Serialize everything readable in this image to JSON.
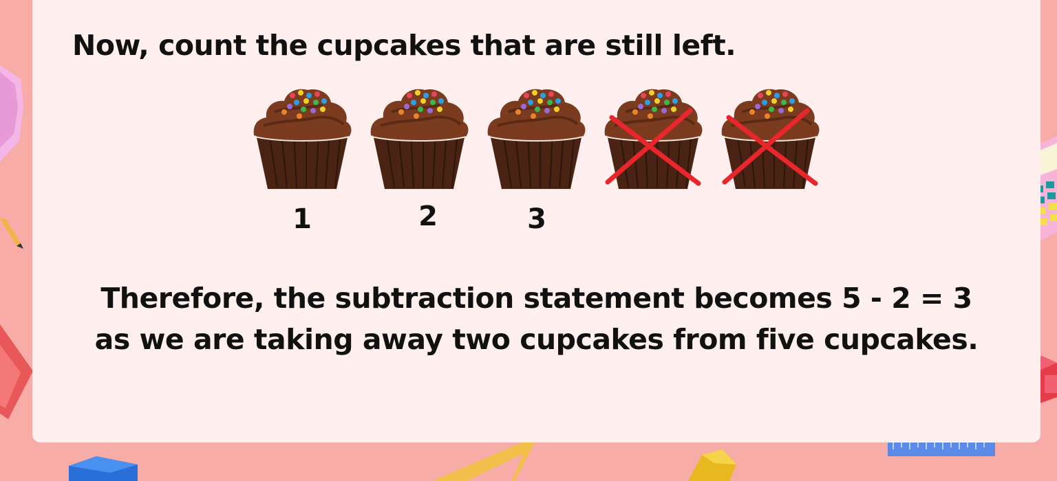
{
  "heading": "Now, count the cupcakes that are still left.",
  "cupcakes": [
    {
      "label": "1",
      "crossed": false
    },
    {
      "label": "2",
      "crossed": false
    },
    {
      "label": "3",
      "crossed": false
    },
    {
      "label": "",
      "crossed": true
    },
    {
      "label": "",
      "crossed": true
    }
  ],
  "statement": {
    "line1": "Therefore, the subtraction statement becomes 5 - 2 = 3",
    "line2": "as we are taking away two cupcakes from five cupcakes."
  },
  "colors": {
    "background": "#f8aca8",
    "card": "#fff0ef",
    "frosting": "#7a3b1e",
    "wrapper": "#4a2314",
    "cross": "#e8262b"
  },
  "decorations": [
    "pink-crystal-icon",
    "pencil-icon",
    "red-gem-icon",
    "calculator-icon",
    "red-cube-icon",
    "ruler-icon",
    "blue-cube-icon",
    "set-square-icon",
    "yellow-gem-icon"
  ]
}
